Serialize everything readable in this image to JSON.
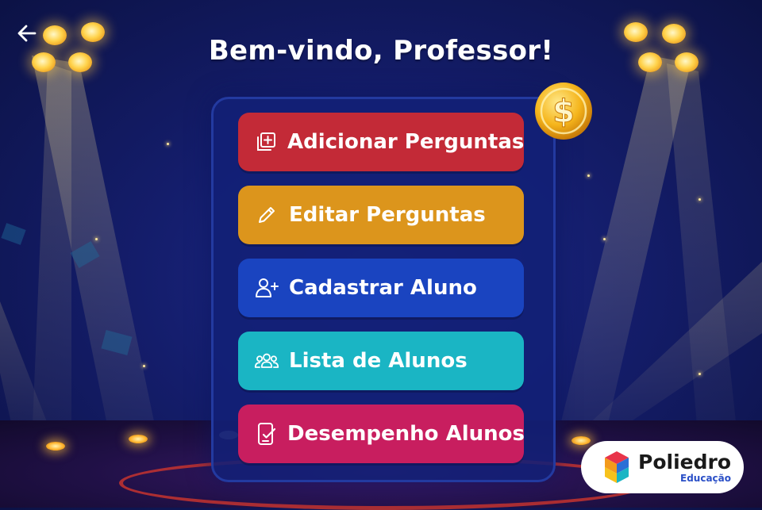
{
  "header": {
    "title": "Bem-vindo, Professor!",
    "back_icon": "arrow-left-icon"
  },
  "decor": {
    "coin_icon": "dollar-coin-icon",
    "spotlight_color": "#ffd24a"
  },
  "menu": {
    "items": [
      {
        "label": "Adicionar Perguntas",
        "icon": "add-library-icon",
        "color": "#c32a37"
      },
      {
        "label": "Editar Perguntas",
        "icon": "pencil-icon",
        "color": "#dc951c"
      },
      {
        "label": "Cadastrar Aluno",
        "icon": "user-plus-icon",
        "color": "#1a44c0"
      },
      {
        "label": "Lista de Alunos",
        "icon": "group-icon",
        "color": "#1ab5c4"
      },
      {
        "label": "Desempenho Alunos",
        "icon": "clipboard-check-icon",
        "color": "#c81e5f"
      }
    ]
  },
  "brand": {
    "name": "Poliedro",
    "subtitle": "Educação"
  }
}
